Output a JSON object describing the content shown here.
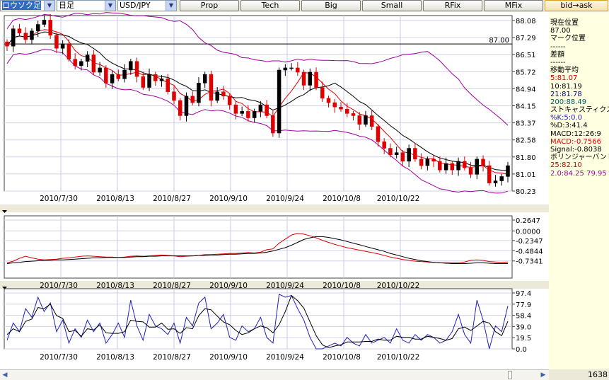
{
  "toolbar": {
    "chart_type": "ロウソク足",
    "period": "日足",
    "pair": "USD/JPY",
    "buttons": [
      "Prop",
      "Tech",
      "Big",
      "Small",
      "RFix",
      "MFix",
      "bid→ask"
    ]
  },
  "info_panel": {
    "lines": [
      {
        "text": "現在位置",
        "color": "#000000"
      },
      {
        "text": "87.00",
        "color": "#000000"
      },
      {
        "text": "マーク位置",
        "color": "#000000"
      },
      {
        "text": "------",
        "color": "#000000"
      },
      {
        "text": "差額",
        "color": "#000000"
      },
      {
        "text": "------",
        "color": "#000000"
      },
      {
        "text": "移動平均",
        "color": "#000000"
      },
      {
        "text": "5:81.07",
        "color": "#cc0000"
      },
      {
        "text": "10:81.19",
        "color": "#000000"
      },
      {
        "text": "21:81.78",
        "color": "#000080"
      },
      {
        "text": "200:88.49",
        "color": "#006060"
      },
      {
        "text": "ストキャスティクス",
        "color": "#000000"
      },
      {
        "text": "%K:5:0.0",
        "color": "#2020c0"
      },
      {
        "text": "%D:3:41.4",
        "color": "#000000"
      },
      {
        "text": "MACD:12:26:9",
        "color": "#000000"
      },
      {
        "text": "MACD:-0.7566",
        "color": "#cc0000"
      },
      {
        "text": "Signal:-0.8038",
        "color": "#000000"
      },
      {
        "text": "ボリンジャーバンド",
        "color": "#000000"
      },
      {
        "text": "25:82.10",
        "color": "#cc0000"
      },
      {
        "text": "2.0:84.25  79.95",
        "color": "#a000a0"
      }
    ]
  },
  "status": {
    "count": "1638"
  },
  "colors": {
    "up": "#000000",
    "down": "#e00000",
    "ma5": "#e00000",
    "ma10": "#000000",
    "bollinger": "#a000a0",
    "stoch_k": "#2020c0",
    "stoch_d": "#000000",
    "macd": "#e00000",
    "signal": "#000000"
  },
  "chart_data": [
    {
      "type": "candlestick",
      "name": "price",
      "x_labels": [
        "2010/7/30",
        "2010/8/13",
        "2010/8/27",
        "2010/9/10",
        "2010/9/24",
        "2010/10/8",
        "2010/10/22"
      ],
      "y_ticks": [
        "88.08",
        "87.29",
        "86.51",
        "85.72",
        "84.94",
        "84.15",
        "83.37",
        "82.58",
        "81.80",
        "81.01",
        "80.23"
      ],
      "ylim": [
        80.23,
        88.08
      ],
      "marker_line": {
        "value": 87.0,
        "label": "87.00"
      },
      "close": [
        86.9,
        87.7,
        87.5,
        87.2,
        87.6,
        87.9,
        88.1,
        87.4,
        86.8,
        87.0,
        86.3,
        86.0,
        86.2,
        86.5,
        85.7,
        85.9,
        85.2,
        85.6,
        85.4,
        85.8,
        86.2,
        85.5,
        85.0,
        85.6,
        85.3,
        85.4,
        84.8,
        84.4,
        83.7,
        84.6,
        84.3,
        85.2,
        85.6,
        84.4,
        84.8,
        84.6,
        84.2,
        83.8,
        83.9,
        83.6,
        83.9,
        84.2,
        83.7,
        82.9,
        85.8,
        85.9,
        85.9,
        85.7,
        85.1,
        85.7,
        85.0,
        84.5,
        84.3,
        84.1,
        84.0,
        83.8,
        83.7,
        83.3,
        83.7,
        83.2,
        82.5,
        82.2,
        81.9,
        82.0,
        81.6,
        82.2,
        81.7,
        81.4,
        81.7,
        81.6,
        81.2,
        81.5,
        81.2,
        81.6,
        81.3,
        81.0,
        81.7,
        81.4,
        80.6,
        80.7,
        80.9,
        81.4
      ],
      "ma5_end": 81.07,
      "ma10_end": 81.19,
      "bollinger": {
        "period": 25,
        "mid": 82.1,
        "upper": 84.25,
        "lower": 79.95
      }
    },
    {
      "type": "line",
      "name": "macd",
      "y_ticks": [
        "0.2647",
        "0.0000",
        "-0.2347",
        "-0.4844",
        "-0.7341"
      ],
      "ylim": [
        -0.86,
        0.2647
      ],
      "series": [
        {
          "name": "MACD",
          "values": [
            -0.78,
            -0.74,
            -0.67,
            -0.62,
            -0.66,
            -0.69,
            -0.71,
            -0.7,
            -0.69,
            -0.67,
            -0.66,
            -0.64,
            -0.62,
            -0.61,
            -0.62,
            -0.63,
            -0.64,
            -0.64,
            -0.65,
            -0.64,
            -0.62,
            -0.61,
            -0.62,
            -0.61,
            -0.6,
            -0.59,
            -0.6,
            -0.61,
            -0.63,
            -0.62,
            -0.61,
            -0.6,
            -0.58,
            -0.58,
            -0.57,
            -0.56,
            -0.55,
            -0.55,
            -0.54,
            -0.53,
            -0.54,
            -0.52,
            -0.46,
            -0.44,
            -0.3,
            -0.2,
            -0.1,
            -0.06,
            -0.08,
            -0.12,
            -0.17,
            -0.23,
            -0.28,
            -0.33,
            -0.37,
            -0.41,
            -0.44,
            -0.47,
            -0.5,
            -0.53,
            -0.56,
            -0.6,
            -0.64,
            -0.67,
            -0.7,
            -0.72,
            -0.74,
            -0.75,
            -0.76,
            -0.77,
            -0.78,
            -0.78,
            -0.78,
            -0.78,
            -0.76,
            -0.72,
            -0.71,
            -0.72,
            -0.75,
            -0.76,
            -0.77,
            -0.76
          ]
        },
        {
          "name": "Signal",
          "values": [
            -0.8,
            -0.78,
            -0.77,
            -0.75,
            -0.74,
            -0.73,
            -0.72,
            -0.72,
            -0.71,
            -0.71,
            -0.7,
            -0.69,
            -0.68,
            -0.67,
            -0.66,
            -0.66,
            -0.65,
            -0.65,
            -0.65,
            -0.65,
            -0.64,
            -0.63,
            -0.63,
            -0.62,
            -0.62,
            -0.61,
            -0.61,
            -0.61,
            -0.61,
            -0.61,
            -0.61,
            -0.6,
            -0.6,
            -0.59,
            -0.59,
            -0.58,
            -0.57,
            -0.57,
            -0.56,
            -0.55,
            -0.55,
            -0.54,
            -0.52,
            -0.49,
            -0.45,
            -0.41,
            -0.35,
            -0.28,
            -0.21,
            -0.17,
            -0.14,
            -0.14,
            -0.16,
            -0.19,
            -0.22,
            -0.26,
            -0.3,
            -0.34,
            -0.38,
            -0.42,
            -0.46,
            -0.5,
            -0.55,
            -0.59,
            -0.63,
            -0.67,
            -0.7,
            -0.73,
            -0.75,
            -0.77,
            -0.78,
            -0.79,
            -0.8,
            -0.8,
            -0.8,
            -0.79,
            -0.78,
            -0.78,
            -0.79,
            -0.8,
            -0.8,
            -0.8
          ]
        }
      ]
    },
    {
      "type": "line",
      "name": "stochastic",
      "y_ticks": [
        "97.4",
        "77.9",
        "58.4",
        "39.0",
        "19.5",
        "0.0"
      ],
      "ylim": [
        0,
        97.4
      ],
      "series": [
        {
          "name": "%K",
          "values": [
            15,
            45,
            30,
            70,
            55,
            90,
            65,
            80,
            30,
            50,
            10,
            35,
            20,
            50,
            30,
            45,
            10,
            25,
            45,
            20,
            85,
            40,
            15,
            60,
            40,
            35,
            25,
            45,
            10,
            55,
            40,
            80,
            90,
            35,
            45,
            60,
            20,
            15,
            40,
            30,
            35,
            55,
            20,
            10,
            95,
            90,
            93,
            70,
            50,
            20,
            0,
            0,
            5,
            10,
            5,
            20,
            10,
            5,
            25,
            10,
            15,
            20,
            10,
            35,
            15,
            10,
            25,
            15,
            25,
            20,
            10,
            15,
            30,
            60,
            25,
            10,
            85,
            50,
            0,
            40,
            30,
            75
          ]
        },
        {
          "name": "%D",
          "values": [
            25,
            35,
            30,
            48,
            52,
            72,
            70,
            78,
            58,
            53,
            30,
            32,
            22,
            35,
            33,
            42,
            28,
            27,
            27,
            30,
            50,
            48,
            47,
            38,
            38,
            45,
            34,
            35,
            27,
            37,
            35,
            58,
            70,
            68,
            57,
            47,
            42,
            32,
            25,
            28,
            35,
            40,
            37,
            28,
            42,
            65,
            93,
            84,
            71,
            47,
            23,
            7,
            2,
            5,
            7,
            12,
            12,
            12,
            13,
            13,
            17,
            15,
            15,
            22,
            20,
            20,
            17,
            17,
            22,
            20,
            18,
            15,
            18,
            35,
            38,
            32,
            40,
            48,
            45,
            30,
            23,
            48
          ]
        }
      ]
    }
  ]
}
